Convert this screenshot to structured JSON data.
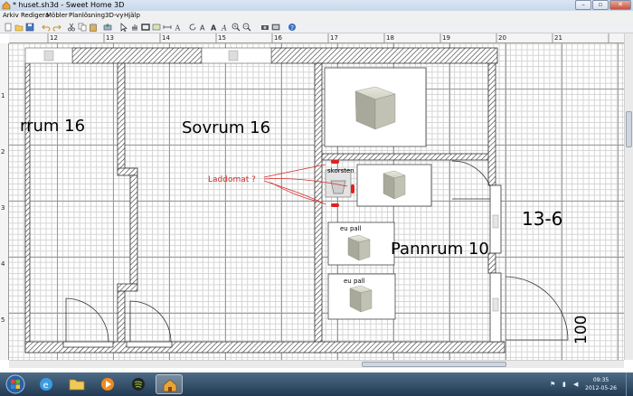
{
  "window": {
    "title": "* huset.sh3d - Sweet Home 3D"
  },
  "menu": [
    "Arkiv",
    "Redigera",
    "Möbler",
    "Planlösning",
    "3D-vy",
    "Hjälp"
  ],
  "ruler": {
    "h": [
      "12",
      "13",
      "14",
      "15",
      "16",
      "17",
      "18",
      "19",
      "20",
      "21"
    ],
    "v": [
      "1",
      "2",
      "3",
      "4",
      "5"
    ]
  },
  "rooms": {
    "left": "rrum 16",
    "sovrum": "Sovrum 16",
    "pannrum": "Pannrum 10",
    "right": "13-6",
    "bottom_right": "100"
  },
  "labels": {
    "skorsten": "skorsten",
    "eu_pall_1": "eu pall",
    "eu_pall_2": "eu pall"
  },
  "annotation": {
    "text": "Laddomat ?",
    "color": "#d62a2a"
  },
  "taskbar": {
    "time": "09:35",
    "date": "2012-05-26"
  },
  "colors": {
    "accent": "#d62a2a",
    "wall_hatch": "#333333",
    "taskbar": "#2e4a64"
  }
}
